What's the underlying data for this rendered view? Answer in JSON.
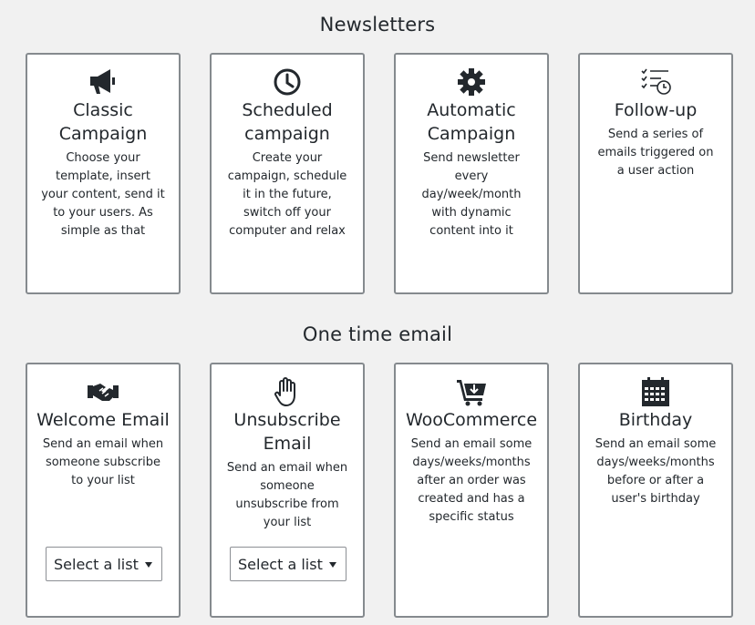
{
  "sections": {
    "newsletters_title": "Newsletters",
    "one_time_title": "One time email"
  },
  "newsletters": [
    {
      "icon": "megaphone-icon",
      "title": "Classic Campaign",
      "description": "Choose your template, insert your content, send it to your users. As simple as that"
    },
    {
      "icon": "clock-icon",
      "title": "Scheduled campaign",
      "description": "Create your campaign, schedule it in the future, switch off your computer and relax"
    },
    {
      "icon": "gear-icon",
      "title": "Automatic Campaign",
      "description": "Send newsletter every day/week/month with dynamic content into it"
    },
    {
      "icon": "checklist-clock-icon",
      "title": "Follow-up",
      "description": "Send a series of emails triggered on a user action"
    }
  ],
  "one_time": [
    {
      "icon": "handshake-icon",
      "title": "Welcome Email",
      "description": "Send an email when someone subscribe to your list",
      "select": "Select a list"
    },
    {
      "icon": "hand-icon",
      "title": "Unsubscribe Email",
      "description": "Send an email when someone unsubscribe from your list",
      "select": "Select a list"
    },
    {
      "icon": "cart-download-icon",
      "title": "WooCommerce",
      "description": "Send an email some days/weeks/months after an order was created and has a specific status"
    },
    {
      "icon": "calendar-icon",
      "title": "Birthday",
      "description": "Send an email some days/weeks/months before or after a user's birthday"
    }
  ]
}
